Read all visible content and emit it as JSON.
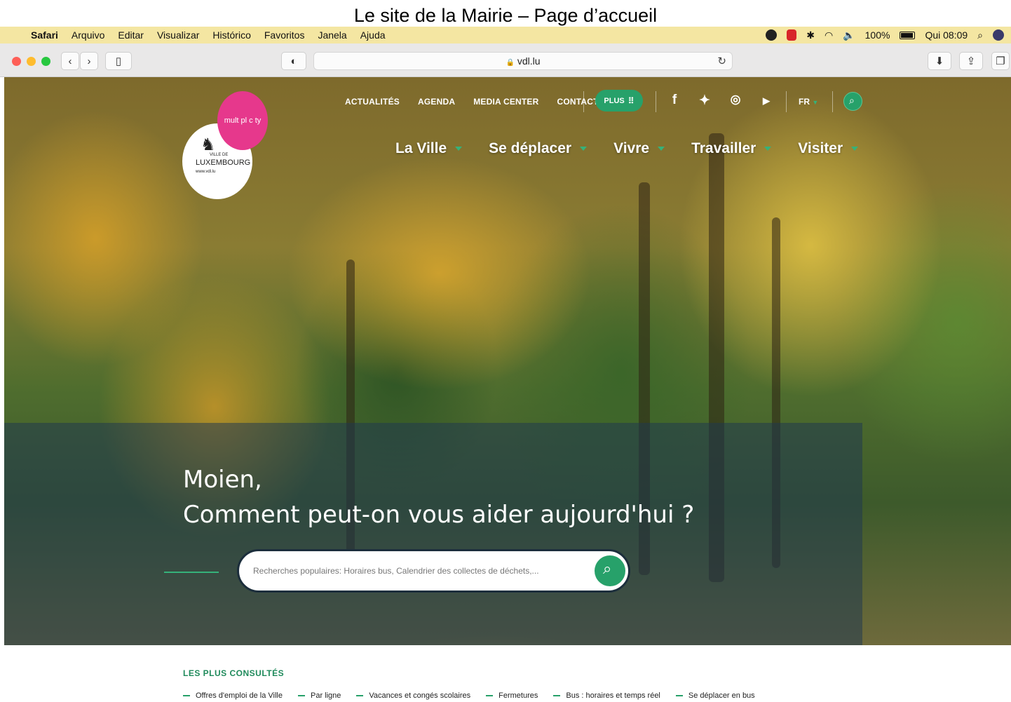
{
  "caption": "Le site de la Mairie – Page d’accueil",
  "menubar": {
    "apple": "",
    "app": "Safari",
    "items": [
      "Arquivo",
      "Editar",
      "Visualizar",
      "Histórico",
      "Favoritos",
      "Janela",
      "Ajuda"
    ],
    "battery": "100%",
    "clock": "Qui 08:09"
  },
  "browser": {
    "url": "vdl.lu",
    "lock": "🔒"
  },
  "site": {
    "topnav": [
      "ACTUALITÉS",
      "AGENDA",
      "MEDIA CENTER",
      "CONTACT"
    ],
    "plus_label": "PLUS",
    "social": [
      "f",
      "t",
      "ig",
      "yt"
    ],
    "lang": "FR",
    "mainnav": [
      "La Ville",
      "Se déplacer",
      "Vivre",
      "Travailler",
      "Visiter"
    ],
    "logo": {
      "badge": "mult pl c ty",
      "line1": "VILLE DE",
      "line2": "LUXEMBOURG",
      "line3": "www.vdl.lu"
    },
    "greeting_line1": "Moien,",
    "greeting_line2": "Comment peut-on vous aider aujourd'hui ?",
    "search_placeholder": "Recherches populaires: Horaires bus, Calendrier des collectes de déchets,...",
    "consulted_title": "LES PLUS CONSULTÉS",
    "consulted_links": [
      "Offres d'emploi de la Ville",
      "Par ligne",
      "Vacances et congés scolaires",
      "Fermetures",
      "Bus : horaires et temps réel",
      "Se déplacer en bus"
    ]
  },
  "colors": {
    "accent_green": "#27a16a",
    "logo_pink": "#e6388c",
    "menubar_bg": "#f4e6a2"
  }
}
